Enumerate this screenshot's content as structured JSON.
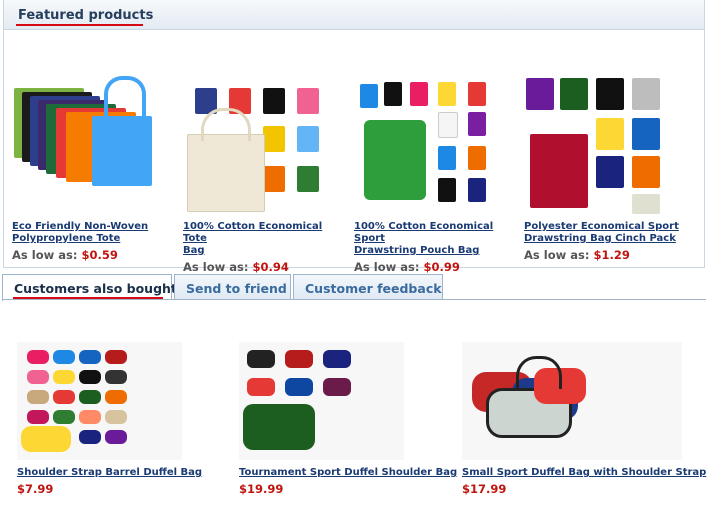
{
  "featured": {
    "title": "Featured products",
    "as_low_as": "As low as:",
    "products": [
      {
        "name_line1": "Eco Friendly Non-Woven",
        "name_line2": "Polypropylene Tote",
        "price": "$0.59"
      },
      {
        "name_line1": "100% Cotton Economical Tote",
        "name_line2": "Bag",
        "price": "$0.94"
      },
      {
        "name_line1": "100% Cotton Economical Sport",
        "name_line2": "Drawstring Pouch Bag",
        "price": "$0.99"
      },
      {
        "name_line1": "Polyester Economical Sport",
        "name_line2": "Drawstring Bag Cinch Pack",
        "price": "$1.29"
      }
    ]
  },
  "tabs": {
    "customers_also_bought": "Customers also bought",
    "send_to_friend": "Send to friend",
    "customer_feedback": "Customer feedback"
  },
  "also_bought": [
    {
      "name": "Shoulder Strap Barrel Duffel Bag",
      "price": "$7.99"
    },
    {
      "name": "Tournament Sport Duffel Shoulder Bag",
      "price": "$19.99"
    },
    {
      "name": "Small Sport Duffel Bag with Shoulder Strap",
      "price": "$17.99"
    }
  ],
  "colors": {
    "accent_red": "#d40a14",
    "link_blue": "#1a3a73",
    "price_red": "#c0140f"
  }
}
